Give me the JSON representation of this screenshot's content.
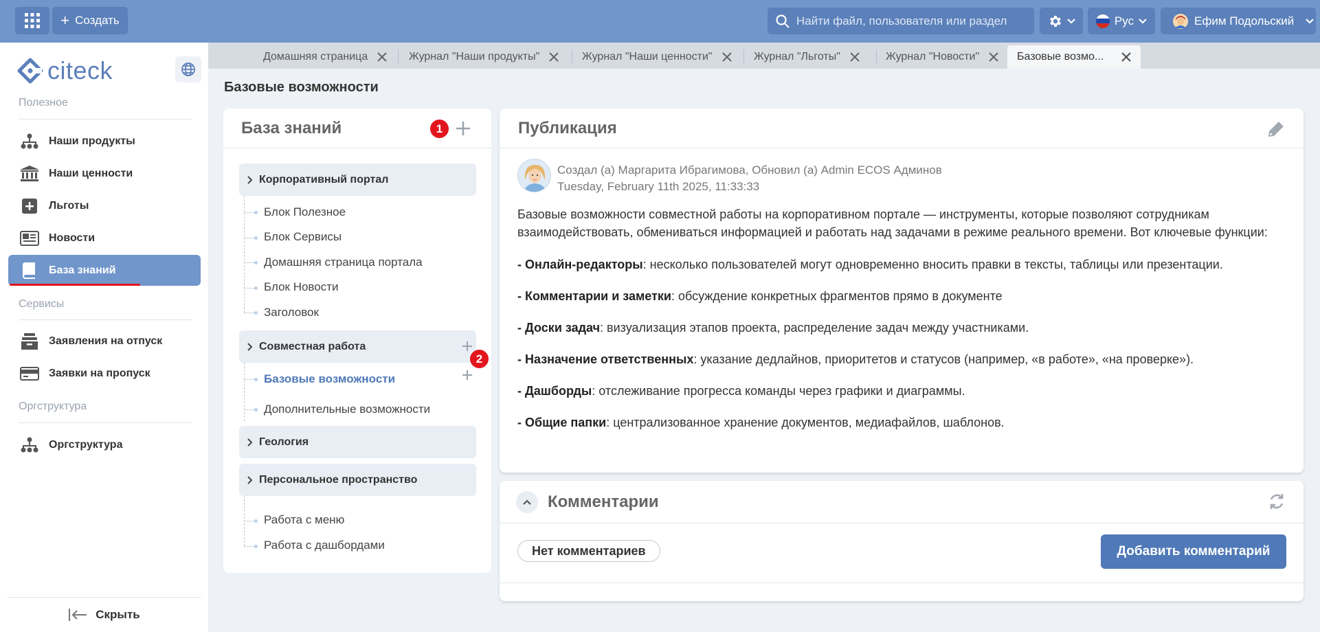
{
  "topbar": {
    "create_label": "Создать",
    "search_placeholder": "Найти файл, пользователя или раздел",
    "lang_label": "Рус",
    "user_name": "Ефим Подольский"
  },
  "sidebar": {
    "logo_text": "citeck",
    "sections": [
      {
        "title": "Полезное"
      },
      {
        "title": "Сервисы"
      },
      {
        "title": "Оргструктура"
      }
    ],
    "items": [
      {
        "label": "Наши продукты",
        "icon": "org-structure-icon"
      },
      {
        "label": "Наши ценности",
        "icon": "bank-icon"
      },
      {
        "label": "Льготы",
        "icon": "plus-square-icon"
      },
      {
        "label": "Новости",
        "icon": "newspaper-icon"
      },
      {
        "label": "База знаний",
        "icon": "book-icon",
        "active": true
      },
      {
        "label": "Заявления на отпуск",
        "icon": "archive-icon"
      },
      {
        "label": "Заявки на пропуск",
        "icon": "card-icon"
      },
      {
        "label": "Оргструктура",
        "icon": "org-structure-icon"
      }
    ],
    "hide_label": "Скрыть"
  },
  "tabs": [
    {
      "label": "Домашняя страница"
    },
    {
      "label": "Журнал \"Наши продукты\""
    },
    {
      "label": "Журнал \"Наши ценности\""
    },
    {
      "label": "Журнал \"Льготы\""
    },
    {
      "label": "Журнал \"Новости\""
    },
    {
      "label": "Базовые возмо...",
      "active": true
    }
  ],
  "page_title": "Базовые возможности",
  "kb": {
    "title": "База знаний",
    "badges": [
      "1",
      "2"
    ],
    "groups": [
      {
        "label": "Корпоративный портал",
        "children": [
          "Блок Полезное",
          "Блок Сервисы",
          "Домашняя страница портала",
          "Блок Новости",
          "Заголовок"
        ]
      },
      {
        "label": "Совместная работа",
        "children": [
          "Базовые возможности",
          "Дополнительные возможности"
        ]
      },
      {
        "label": "Геология",
        "children": []
      },
      {
        "label": "Персональное пространство",
        "children": [
          "Работа с меню",
          "Работа с дашбордами"
        ]
      }
    ]
  },
  "publication": {
    "title": "Публикация",
    "author_line": "Создал (а) Маргарита Ибрагимова, Обновил (а) Admin ECOS Админов",
    "date_line": "Tuesday, February 11th 2025, 11:33:33",
    "intro": "Базовые возможности совместной работы на корпоративном портале — инструменты, которые позволяют сотрудникам взаимодействовать, обмениваться информацией и работать над задачами в режиме реального времени. Вот ключевые функции:",
    "points": [
      {
        "term": "- Онлайн-редакторы",
        "text": ": несколько пользователей могут одновременно вносить правки в тексты, таблицы или презентации."
      },
      {
        "term": "- Комментарии и заметки",
        "text": ": обсуждение конкретных фрагментов прямо в документе"
      },
      {
        "term": "- Доски задач",
        "text": ": визуализация этапов проекта, распределение задач между участниками."
      },
      {
        "term": "- Назначение ответственных",
        "text": ": указание дедлайнов, приоритетов и статусов (например, «в работе», «на проверке»)."
      },
      {
        "term": "- Дашборды",
        "text": ": отслеживание прогресса команды через графики и диаграммы."
      },
      {
        "term": "- Общие папки",
        "text": ": централизованное хранение документов, медиафайлов, шаблонов."
      }
    ]
  },
  "comments": {
    "title": "Комментарии",
    "empty_label": "Нет комментариев",
    "add_label": "Добавить комментарий"
  },
  "colors": {
    "topbar": "#7196cb",
    "button": "#5b80ba",
    "accent": "#4f79b8",
    "badge": "#e3151d"
  }
}
